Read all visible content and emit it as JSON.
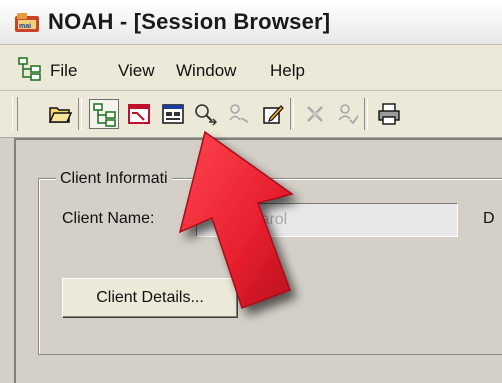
{
  "window": {
    "title": "NOAH - [Session Browser]",
    "app_icon": "noah-app-icon"
  },
  "menu": {
    "icon": "tree-view-icon",
    "items": [
      "File",
      "View",
      "Window",
      "Help"
    ]
  },
  "toolbar": {
    "buttons": [
      {
        "icon": "open-folder-icon"
      },
      {
        "icon": "tree-view-icon",
        "pressed": true
      },
      {
        "icon": "chart-window-icon"
      },
      {
        "icon": "form-window-icon"
      },
      {
        "icon": "search-person-icon"
      },
      {
        "icon": "person-arrow-icon",
        "disabled": true
      },
      {
        "icon": "edit-document-icon"
      },
      {
        "icon": "delete-icon",
        "disabled": true
      },
      {
        "icon": "check-person-icon",
        "disabled": true
      },
      {
        "icon": "printer-icon"
      }
    ]
  },
  "client_info": {
    "group_label": "Client Informati",
    "name_label": "Client Name:",
    "name_value": "Carol",
    "next_label": "D",
    "details_button": "Client Details..."
  },
  "annotation": {
    "arrow_color": "#e8202f"
  }
}
